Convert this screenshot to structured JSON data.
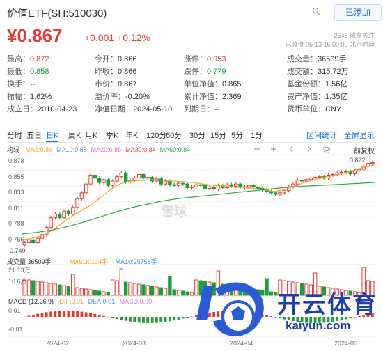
{
  "header": {
    "title": "价值ETF(SH:510030)",
    "add_label": "已添加"
  },
  "quote": {
    "price": "¥0.867",
    "change": "+0.001 +0.12%",
    "followers": "2643 球友关注",
    "status_time": "已收盘 05-13 15:00:00 北京时间"
  },
  "stats": [
    [
      {
        "k": "最高：",
        "v": "0.872",
        "c": "up"
      },
      {
        "k": "今开：",
        "v": "0.866",
        "c": "nt"
      },
      {
        "k": "涨停：",
        "v": "0.953",
        "c": "up"
      },
      {
        "k": "成交量：",
        "v": "36509手",
        "c": "nt"
      }
    ],
    [
      {
        "k": "最低：",
        "v": "0.858",
        "c": "dn"
      },
      {
        "k": "昨收：",
        "v": "0.866",
        "c": "nt"
      },
      {
        "k": "跌停：",
        "v": "0.779",
        "c": "dn"
      },
      {
        "k": "成交额：",
        "v": "315.72万",
        "c": "nt"
      }
    ],
    [
      {
        "k": "换手：",
        "v": "--",
        "c": "nt"
      },
      {
        "k": "市价：",
        "v": "0.867",
        "c": "nt"
      },
      {
        "k": "单位净值：",
        "v": "0.865",
        "c": "nt"
      },
      {
        "k": "基金份额：",
        "v": "1.56亿",
        "c": "nt"
      }
    ],
    [
      {
        "k": "振幅：",
        "v": "1.62%",
        "c": "nt"
      },
      {
        "k": "溢价率：",
        "v": "-0.20%",
        "c": "nt"
      },
      {
        "k": "累计净值：",
        "v": "2.369",
        "c": "nt"
      },
      {
        "k": "资产净值：",
        "v": "1.35亿",
        "c": "nt"
      }
    ],
    [
      {
        "k": "成立日：",
        "v": "2010-04-23",
        "c": "nt"
      },
      {
        "k": "净值日期：",
        "v": "2024-05-10",
        "c": "nt"
      },
      {
        "k": "到期日：",
        "v": "--",
        "c": "nt"
      },
      {
        "k": "货币单位：",
        "v": "CNY",
        "c": "nt"
      }
    ]
  ],
  "tabs": [
    "分时",
    "五日",
    "日K",
    "周K",
    "月K",
    "季K",
    "年K",
    "120分",
    "60分",
    "30分",
    "15分",
    "5分",
    "1分"
  ],
  "active_tab": "日K",
  "tab_actions": [
    "区间统计",
    "全屏显示"
  ],
  "indicators": {
    "line_label": "均线",
    "ma": [
      {
        "label": "MA5:0.86",
        "color": "#f5a623"
      },
      {
        "label": "MA10:0.85",
        "color": "#4a90e2"
      },
      {
        "label": "MA20:0.85",
        "color": "#d86fd0"
      },
      {
        "label": "MA30:0.84",
        "color": "#e53935"
      },
      {
        "label": "MA60:0.84",
        "color": "#2ea84a"
      }
    ],
    "adjust": "前复权"
  },
  "price_axis": [
    "0.878",
    "0.855",
    "0.833",
    "0.811",
    "0.788",
    "0.766"
  ],
  "price_low_label": "0.749",
  "price_high_label": "0.872",
  "volume_info": {
    "label": "成交量 36509手",
    "ma5": "MA5:30134手",
    "ma10": "MA10:25758手",
    "axis": [
      "21.13万",
      "10.6万"
    ]
  },
  "macd_info": {
    "label": "MACD (12,26,9)",
    "dif": "DIF:0.01",
    "dea": "DEA:0.01",
    "macd": "MACD:0.00",
    "axis": [
      "0.01",
      "-0.01"
    ]
  },
  "x_dates": [
    "2024-02",
    "2024-03",
    "2024-04",
    "2024-05"
  ],
  "watermark_center": "雪球",
  "watermark_brand": "开云体育",
  "watermark_url": "kaiyun.com",
  "colors": {
    "up": "#e53935",
    "down": "#1e9e3a",
    "accent": "#1a6de0"
  },
  "chart_data": {
    "type": "candlestick",
    "x_range": [
      "2024-01-22",
      "2024-05-13"
    ],
    "ylim": [
      0.749,
      0.878
    ],
    "candles_close": [
      0.758,
      0.762,
      0.758,
      0.764,
      0.769,
      0.779,
      0.792,
      0.797,
      0.792,
      0.801,
      0.797,
      0.806,
      0.818,
      0.826,
      0.838,
      0.85,
      0.846,
      0.84,
      0.844,
      0.836,
      0.842,
      0.848,
      0.853,
      0.841,
      0.843,
      0.846,
      0.851,
      0.846,
      0.847,
      0.842,
      0.845,
      0.838,
      0.842,
      0.837,
      0.836,
      0.839,
      0.838,
      0.833,
      0.834,
      0.837,
      0.836,
      0.832,
      0.834,
      0.831,
      0.836,
      0.833,
      0.837,
      0.835,
      0.838,
      0.834,
      0.833,
      0.836,
      0.834,
      0.832,
      0.83,
      0.828,
      0.826,
      0.824,
      0.826,
      0.829,
      0.834,
      0.838,
      0.843,
      0.842,
      0.844,
      0.846,
      0.847,
      0.848,
      0.846,
      0.85,
      0.851,
      0.853,
      0.854,
      0.855,
      0.852,
      0.856,
      0.858,
      0.862,
      0.866,
      0.867
    ],
    "series": [
      {
        "name": "MA5",
        "values": [
          0.762,
          0.764,
          0.768,
          0.775,
          0.785,
          0.795,
          0.803,
          0.811,
          0.822,
          0.833,
          0.84,
          0.842,
          0.843,
          0.844,
          0.843,
          0.842,
          0.841,
          0.84,
          0.838,
          0.836,
          0.835,
          0.834,
          0.833,
          0.832,
          0.83,
          0.828,
          0.83,
          0.835,
          0.84,
          0.844,
          0.847,
          0.85,
          0.853,
          0.857,
          0.861,
          0.864
        ]
      },
      {
        "name": "MA60",
        "values": [
          0.77,
          0.772,
          0.775,
          0.779,
          0.784,
          0.79,
          0.796,
          0.802,
          0.807,
          0.811,
          0.815,
          0.818,
          0.82,
          0.822,
          0.824,
          0.826,
          0.828,
          0.83,
          0.832,
          0.834,
          0.835,
          0.836,
          0.837,
          0.838,
          0.839,
          0.84
        ]
      }
    ]
  }
}
